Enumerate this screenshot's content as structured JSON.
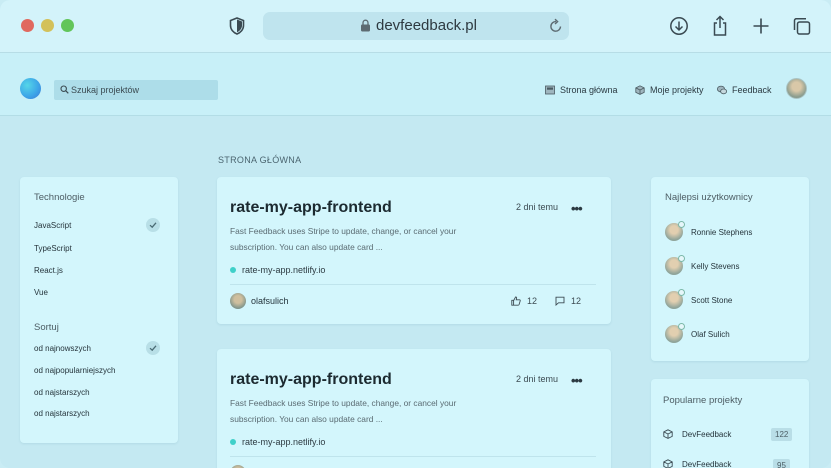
{
  "browser": {
    "url": "devfeedback.pl"
  },
  "header": {
    "search_placeholder": "Szukaj projektów",
    "nav": [
      {
        "label": "Strona główna"
      },
      {
        "label": "Moje projekty"
      },
      {
        "label": "Feedback"
      }
    ]
  },
  "sidebar": {
    "technologies_title": "Technologie",
    "technologies": [
      {
        "label": "JavaScript",
        "checked": true
      },
      {
        "label": "TypeScript",
        "checked": false
      },
      {
        "label": "React.js",
        "checked": false
      },
      {
        "label": "Vue",
        "checked": false
      }
    ],
    "sort_title": "Sortuj",
    "sort": [
      {
        "label": "od najnowszych",
        "checked": true
      },
      {
        "label": "od najpopularniejszych",
        "checked": false
      },
      {
        "label": "od najstarszych",
        "checked": false
      },
      {
        "label": "od najstarszych",
        "checked": false
      }
    ]
  },
  "main": {
    "section_label": "STRONA GŁÓWNA",
    "projects": [
      {
        "title": "rate-my-app-frontend",
        "date": "2 dni temu",
        "desc_line1": "Fast Feedback uses Stripe to update, change, or cancel your",
        "desc_line2": "subscription. You can also update card ...",
        "link": "rate-my-app.netlify.io",
        "author": "olafsulich",
        "likes": "12",
        "comments": "12"
      },
      {
        "title": "rate-my-app-frontend",
        "date": "2 dni temu",
        "desc_line1": "Fast Feedback uses Stripe to update, change, or cancel your",
        "desc_line2": "subscription. You can also update card ...",
        "link": "rate-my-app.netlify.io"
      }
    ]
  },
  "right": {
    "best_users_title": "Najlepsi użytkownicy",
    "users": [
      {
        "name": "Ronnie Stephens"
      },
      {
        "name": "Kelly Stevens"
      },
      {
        "name": "Scott Stone"
      },
      {
        "name": "Olaf Sulich"
      }
    ],
    "popular_title": "Popularne projekty",
    "popular": [
      {
        "name": "DevFeedback",
        "count": "122"
      },
      {
        "name": "DevFeedback",
        "count": "95"
      }
    ]
  },
  "colors": {
    "accent": "#3fd0c9",
    "background": "#c4e9f2",
    "card": "#d3f6fc"
  }
}
